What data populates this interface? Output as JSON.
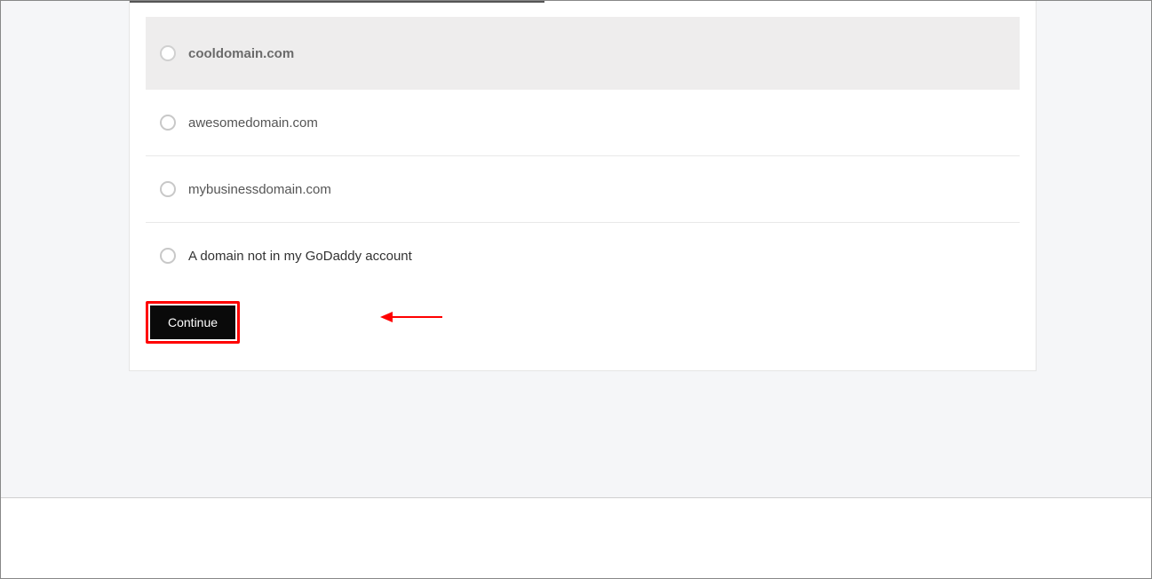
{
  "options": [
    {
      "label": "cooldomain.com",
      "selected": true
    },
    {
      "label": "awesomedomain.com",
      "selected": false
    },
    {
      "label": "mybusinessdomain.com",
      "selected": false
    },
    {
      "label": "A domain not in my GoDaddy account",
      "selected": false
    }
  ],
  "button": {
    "continue_label": "Continue"
  },
  "annotation": {
    "highlight_color": "#ff0000"
  }
}
